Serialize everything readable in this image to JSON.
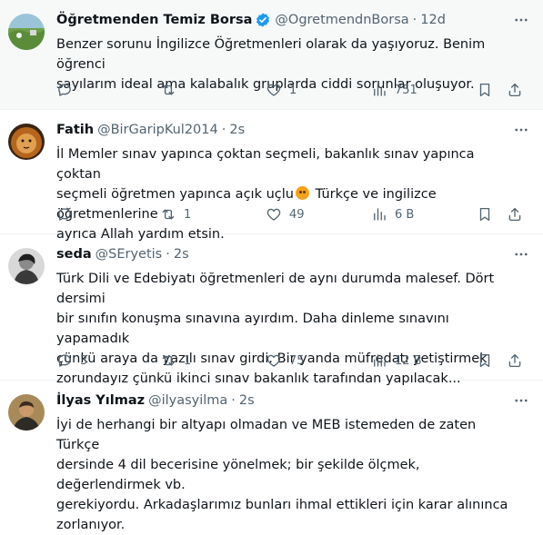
{
  "tweets": [
    {
      "name": "Öğretmenden Temiz Borsa",
      "verified": true,
      "handle": "@OgretmendnBorsa",
      "time": "12d",
      "text_before": "Benzer sorunu İngilizce Öğretmenleri olarak da yaşıyoruz. Benim öğrenci\nsayılarım ideal ama kalabalık gruplarda ciddi sorunlar oluşuyor.",
      "text_after": "",
      "reply_count": "",
      "retweet_count": "",
      "like_count": "1",
      "view_count": "751",
      "avatar_icon": "landscape-avatar"
    },
    {
      "name": "Fatih",
      "verified": false,
      "handle": "@BirGaripKul2014",
      "time": "2s",
      "text_before": "İl Memler sınav yapınca çoktan seçmeli, bakanlık sınav yapınca çoktan\nseçmeli öğretmen yapınca açık uçlu",
      "text_after": " Türkçe ve ingilizce öğretmenlerine\nayrıca Allah yardım etsin.",
      "reply_count": "",
      "retweet_count": "1",
      "like_count": "49",
      "view_count": "6 B",
      "avatar_icon": "lion-avatar"
    },
    {
      "name": "seda",
      "verified": false,
      "handle": "@SEryetis",
      "time": "2s",
      "text_before": "Türk Dili ve Edebiyatı öğretmenleri de aynı durumda malesef. Dört dersimi\nbir sınıfın konuşma sınavına ayırdım. Daha dinleme sınavını yapamadık\nçünkü araya da yazılı sınav girdi. Bir yanda müfredatı yetiştirmek\nzorundayız çünkü ikinci sınav bakanlık tarafından yapılacak...",
      "text_after": "",
      "reply_count": "3",
      "retweet_count": "1",
      "like_count": "75",
      "view_count": "12 B",
      "avatar_icon": "bw-portrait-avatar"
    },
    {
      "name": "İlyas Yılmaz",
      "verified": false,
      "handle": "@ilyasyilma",
      "time": "2s",
      "text_before": "İyi de herhangi bir altyapı olmadan ve MEB istemeden de zaten Türkçe\ndersinde 4 dil becerisine yönelmek; bir şekilde ölçmek, değerlendirmek vb.\ngerekiyordu. Arkadaşlarımız bunları ihmal ettikleri için karar alınınca\nzorlanıyor.",
      "text_after": "",
      "reply_count": "",
      "retweet_count": "",
      "like_count": "",
      "view_count": "",
      "avatar_icon": "portrait-avatar"
    }
  ],
  "colors": {
    "accent": "#1d9bf0",
    "muted": "#536471",
    "text": "#0f1419",
    "highlight_bg": "#f7f9f9"
  }
}
